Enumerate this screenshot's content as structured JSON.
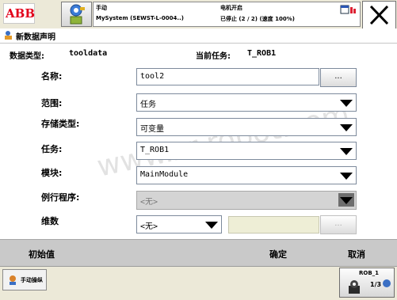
{
  "header": {
    "logo_text": "ABB",
    "mode": "手动",
    "system": "MySystem (SEWST-L-0004..)",
    "motor_status": "电机开启",
    "run_status": "已停止 (2 / 2) (速度 100%)"
  },
  "title": "新数据声明",
  "info": {
    "data_type_label": "数据类型:",
    "data_type_value": "tooldata",
    "task_label": "当前任务:",
    "task_value": "T_ROB1"
  },
  "form": {
    "name_label": "名称:",
    "name_value": "tool2",
    "name_button": "...",
    "scope_label": "范围:",
    "scope_value": "任务",
    "storage_label": "存储类型:",
    "storage_value": "可变量",
    "task_label": "任务:",
    "task_value": "T_ROB1",
    "module_label": "模块:",
    "module_value": "MainModule",
    "routine_label": "例行程序:",
    "routine_value": "<无>",
    "dimension_label": "维数",
    "dimension_value": "<无>",
    "dimension_button": "..."
  },
  "watermark": "www.zr-robot.com",
  "commands": {
    "initial_value": "初始值",
    "ok": "确定",
    "cancel": "取消"
  },
  "taskbar": {
    "manual_label": "手动操纵",
    "rob_label": "ROB_1",
    "rob_fraction": "1/3"
  }
}
